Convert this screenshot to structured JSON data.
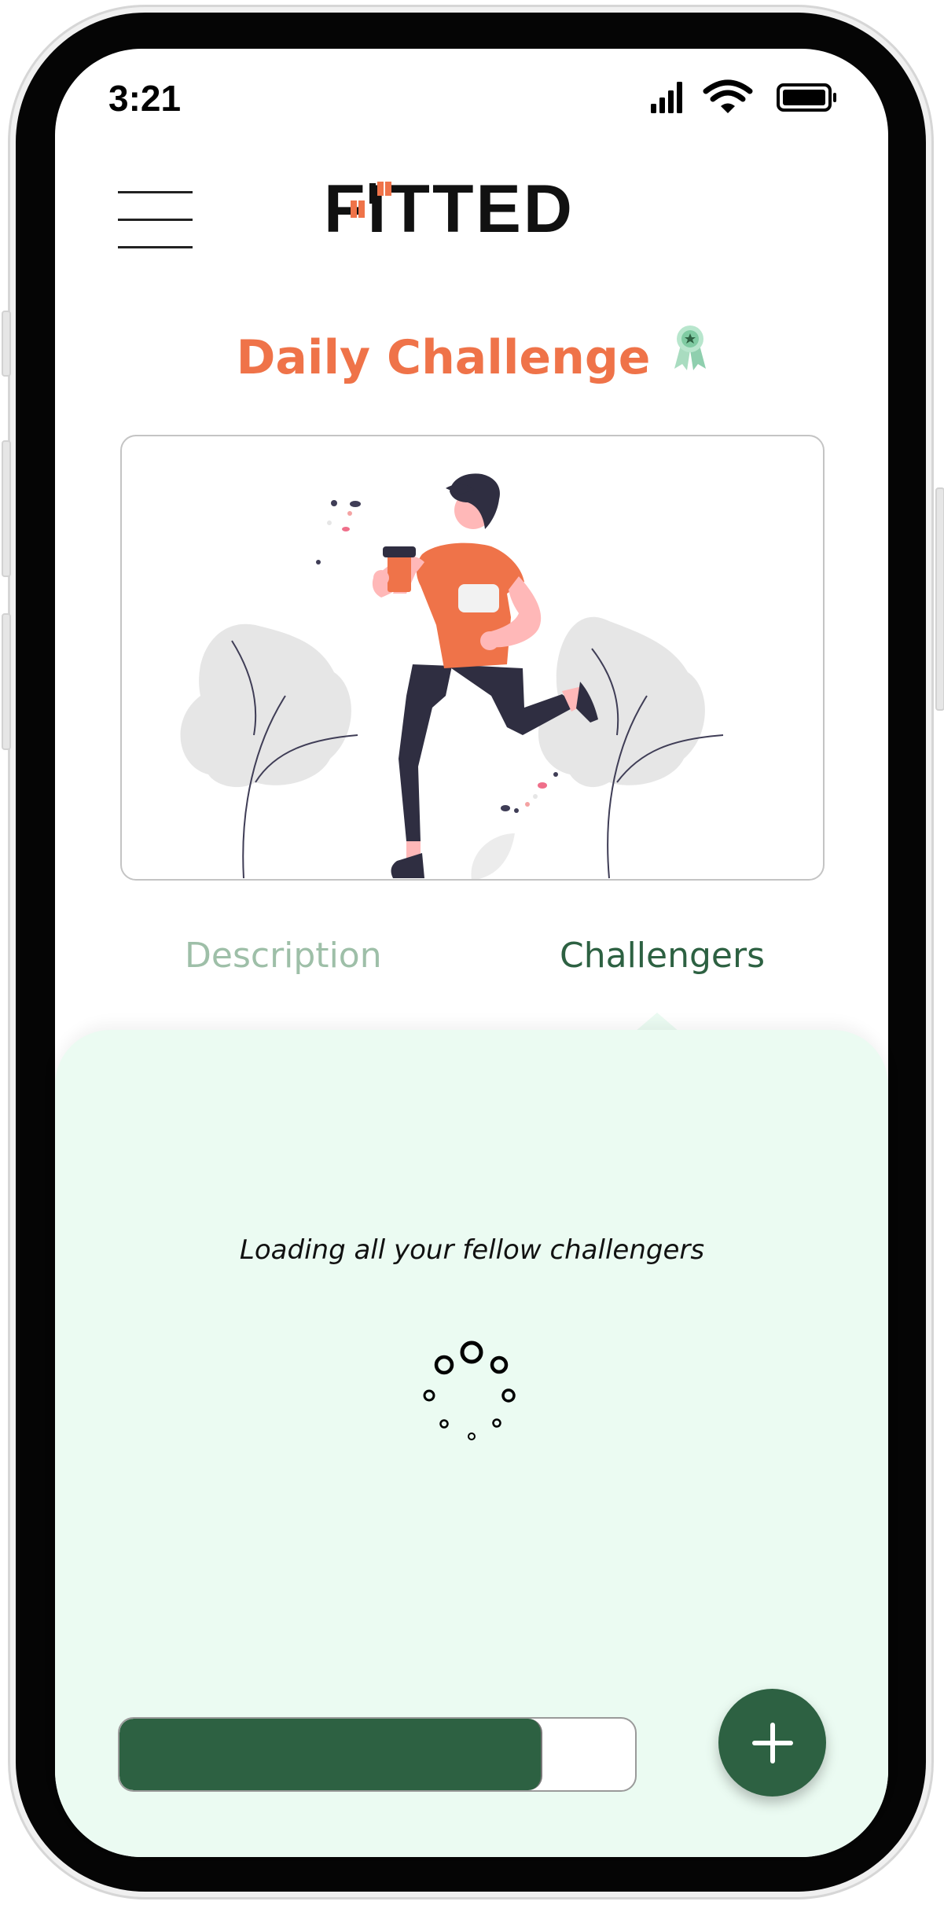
{
  "status_bar": {
    "time": "3:21",
    "icons": [
      "cellular-signal-icon",
      "wifi-icon",
      "battery-icon"
    ]
  },
  "header": {
    "menu_icon": "hamburger-menu-icon",
    "logo_text": "FITTED"
  },
  "page": {
    "title": "Daily Challenge",
    "title_icon": "award-ribbon-icon"
  },
  "hero": {
    "illustration": "person-running-with-coffee-illustration"
  },
  "tabs": [
    {
      "label": "Description",
      "active": false
    },
    {
      "label": "Challengers",
      "active": true
    }
  ],
  "panel": {
    "loading_text": "Loading all your fellow challengers",
    "spinner_icon": "loading-dots-spinner-icon"
  },
  "progress": {
    "fraction": 0.82
  },
  "fab": {
    "icon": "plus-icon"
  },
  "colors": {
    "accent_orange": "#ef7349",
    "brand_green": "#2d6142",
    "inactive_tab": "#9ebfa8",
    "panel_bg": "#ebfbf2"
  }
}
